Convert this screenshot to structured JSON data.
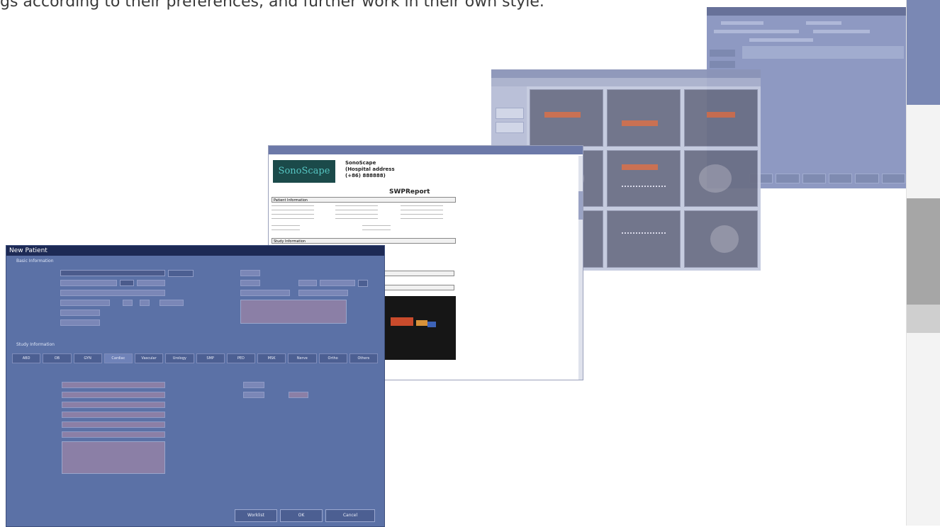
{
  "headline": "gs according to their preferences, and further work in their own style.",
  "report": {
    "logo": "SonoScape",
    "hospital_lines": [
      "SonoScape",
      "(Hospital address",
      "(+86) 888888)"
    ],
    "title": "SWPReport",
    "sections": [
      "Patient Information",
      "Study Information"
    ]
  },
  "new_patient": {
    "title": "New Patient",
    "basic_section": "Basic Information",
    "study_section": "Study Information",
    "tabs": [
      "ABD",
      "OB",
      "GYN",
      "Cardiac",
      "Vascular",
      "Urology",
      "SMP",
      "PED",
      "MSK",
      "Nerve",
      "Ortho",
      "Others"
    ],
    "footer_buttons": [
      "Worklist",
      "OK",
      "Cancel"
    ]
  },
  "colors": {
    "np_bg": "#5b71a6",
    "np_title": "#1d2a55",
    "report_logo_bg": "#1b4a4a",
    "report_logo_text": "#56c6c3"
  }
}
